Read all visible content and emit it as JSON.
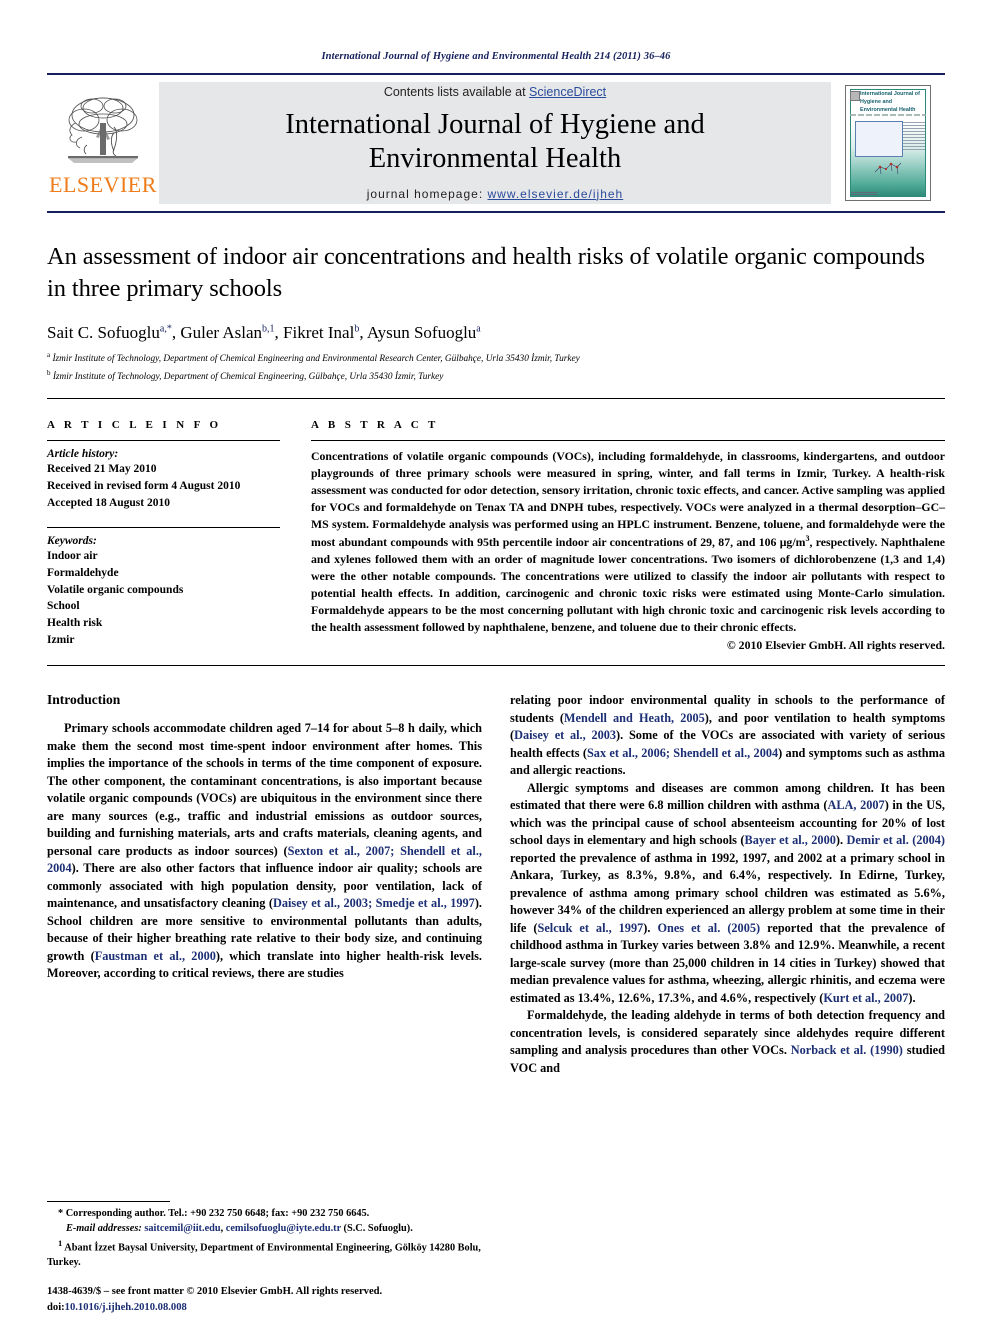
{
  "running_head": "International Journal of Hygiene and Environmental Health 214 (2011) 36–46",
  "masthead": {
    "publisher_name": "ELSEVIER",
    "contents_prefix": "Contents lists available at ",
    "contents_link": "ScienceDirect",
    "journal_title_line1": "International Journal of Hygiene and",
    "journal_title_line2": "Environmental Health",
    "homepage_label": "journal homepage:",
    "homepage_url": "www.elsevier.de/ijheh",
    "cover_title": "International Journal of Hygiene and Environmental Health"
  },
  "article": {
    "title": "An assessment of indoor air concentrations and health risks of volatile organic compounds in three primary schools",
    "authors_html": "Sait C. Sofuoglu<sup>a,*</sup>, Guler Aslan<sup>b,1</sup>, Fikret Inal<sup>b</sup>, Aysun Sofuoglu<sup>a</sup>",
    "affiliation_a": "İzmir Institute of Technology, Department of Chemical Engineering and Environmental Research Center, Gülbahçe, Urla 35430 İzmir, Turkey",
    "affiliation_b": "İzmir Institute of Technology, Department of Chemical Engineering, Gülbahçe, Urla 35430 İzmir, Turkey"
  },
  "article_info": {
    "heading": "A R T I C L E   I N F O",
    "history_label": "Article history:",
    "history": [
      "Received 21 May 2010",
      "Received in revised form 4 August 2010",
      "Accepted 18 August 2010"
    ],
    "keywords_label": "Keywords:",
    "keywords": [
      "Indoor air",
      "Formaldehyde",
      "Volatile organic compounds",
      "School",
      "Health risk",
      "Izmir"
    ]
  },
  "abstract": {
    "heading": "A B S T R A C T",
    "body_part1": "Concentrations of volatile organic compounds (VOCs), including formaldehyde, in classrooms, kindergartens, and outdoor playgrounds of three primary schools were measured in spring, winter, and fall terms in Izmir, Turkey. A health-risk assessment was conducted for odor detection, sensory irritation, chronic toxic effects, and cancer. Active sampling was applied for VOCs and formaldehyde on Tenax TA and DNPH tubes, respectively. VOCs were analyzed in a thermal desorption–GC–MS system. Formaldehyde analysis was performed using an HPLC instrument. Benzene, toluene, and formaldehyde were the most abundant compounds with 95th percentile indoor air concentrations of 29, 87, and 106 μg/m",
    "body_sup": "3",
    "body_part2": ", respectively. Naphthalene and xylenes followed them with an order of magnitude lower concentrations. Two isomers of dichlorobenzene (1,3 and 1,4) were the other notable compounds. The concentrations were utilized to classify the indoor air pollutants with respect to potential health effects. In addition, carcinogenic and chronic toxic risks were estimated using Monte-Carlo simulation. Formaldehyde appears to be the most concerning pollutant with high chronic toxic and carcinogenic risk levels according to the health assessment followed by naphthalene, benzene, and toluene due to their chronic effects.",
    "copyright": "© 2010 Elsevier GmbH. All rights reserved."
  },
  "introduction": {
    "heading": "Introduction",
    "left_p1_a": "Primary schools accommodate children aged 7–14 for about 5–8 h daily, which make them the second most time-spent indoor environment after homes. This implies the importance of the schools in terms of the time component of exposure. The other component, the contaminant concentrations, is also important because volatile organic compounds (VOCs) are ubiquitous in the environment since there are many sources (e.g., traffic and industrial emissions as outdoor sources, building and furnishing materials, arts and crafts materials, cleaning agents, and personal care products as indoor sources) (",
    "left_cite1": "Sexton et al., 2007; Shendell et al., 2004",
    "left_p1_b": "). There are also other factors that influence indoor air quality; schools are commonly associated with high population density, poor ventilation, lack of maintenance, and unsatisfactory cleaning (",
    "left_cite2": "Daisey et al., 2003; Smedje et al., 1997",
    "left_p1_c": "). School children are more sensitive to environmental pollutants than adults, because of their higher breathing rate relative to their body size, and continuing growth (",
    "left_cite3": "Faustman et al., 2000",
    "left_p1_d": "), which translate into higher health-risk levels. Moreover, according to critical reviews, there are studies",
    "right_p1_a": "relating poor indoor environmental quality in schools to the performance of students (",
    "right_cite1": "Mendell and Heath, 2005",
    "right_p1_b": "), and poor ventilation to health symptoms (",
    "right_cite2": "Daisey et al., 2003",
    "right_p1_c": "). Some of the VOCs are associated with variety of serious health effects (",
    "right_cite3": "Sax et al., 2006; Shendell et al., 2004",
    "right_p1_d": ") and symptoms such as asthma and allergic reactions.",
    "right_p2_a": "Allergic symptoms and diseases are common among children. It has been estimated that there were 6.8 million children with asthma (",
    "right_cite4": "ALA, 2007",
    "right_p2_b": ") in the US, which was the principal cause of school absenteeism accounting for 20% of lost school days in elementary and high schools (",
    "right_cite5": "Bayer et al., 2000",
    "right_p2_c": "). ",
    "right_cite6": "Demir et al. (2004)",
    "right_p2_d": " reported the prevalence of asthma in 1992, 1997, and 2002 at a primary school in Ankara, Turkey, as 8.3%, 9.8%, and 6.4%, respectively. In Edirne, Turkey, prevalence of asthma among primary school children was estimated as 5.6%, however 34% of the children experienced an allergy problem at some time in their life (",
    "right_cite7": "Selcuk et al., 1997",
    "right_p2_e": "). ",
    "right_cite8": "Ones et al. (2005)",
    "right_p2_f": " reported that the prevalence of childhood asthma in Turkey varies between 3.8% and 12.9%. Meanwhile, a recent large-scale survey (more than 25,000 children in 14 cities in Turkey) showed that median prevalence values for asthma, wheezing, allergic rhinitis, and eczema were estimated as 13.4%, 12.6%, 17.3%, and 4.6%, respectively (",
    "right_cite9": "Kurt et al., 2007",
    "right_p2_g": ").",
    "right_p3_a": "Formaldehyde, the leading aldehyde in terms of both detection frequency and concentration levels, is considered separately since aldehydes require different sampling and analysis procedures than other VOCs. ",
    "right_cite10": "Norback et al. (1990)",
    "right_p3_b": " studied VOC and"
  },
  "footnotes": {
    "corresponding_marker": "*",
    "corresponding": " Corresponding author. Tel.: +90 232 750 6648; fax: +90 232 750 6645.",
    "email_label": "E-mail addresses:",
    "email1": "saitcemil@iit.edu",
    "email2": "cemilsofuoglu@iyte.edu.tr",
    "email_suffix": " (S.C. Sofuoglu).",
    "note1_marker": "1",
    "note1": " Abant İzzet Baysal University, Department of Environmental Engineering, Gölköy 14280 Bolu, Turkey."
  },
  "imprint": {
    "line1": "1438-4639/$ – see front matter © 2010 Elsevier GmbH. All rights reserved.",
    "doi_label": "doi:",
    "doi_value": "10.1016/j.ijheh.2010.08.008"
  },
  "colors": {
    "journal_navy": "#16205c",
    "link_blue": "#2a4b9b",
    "citation_blue": "#1c2f74",
    "elsevier_orange": "#ef7c1a",
    "masthead_gray": "#e6e7e8"
  }
}
